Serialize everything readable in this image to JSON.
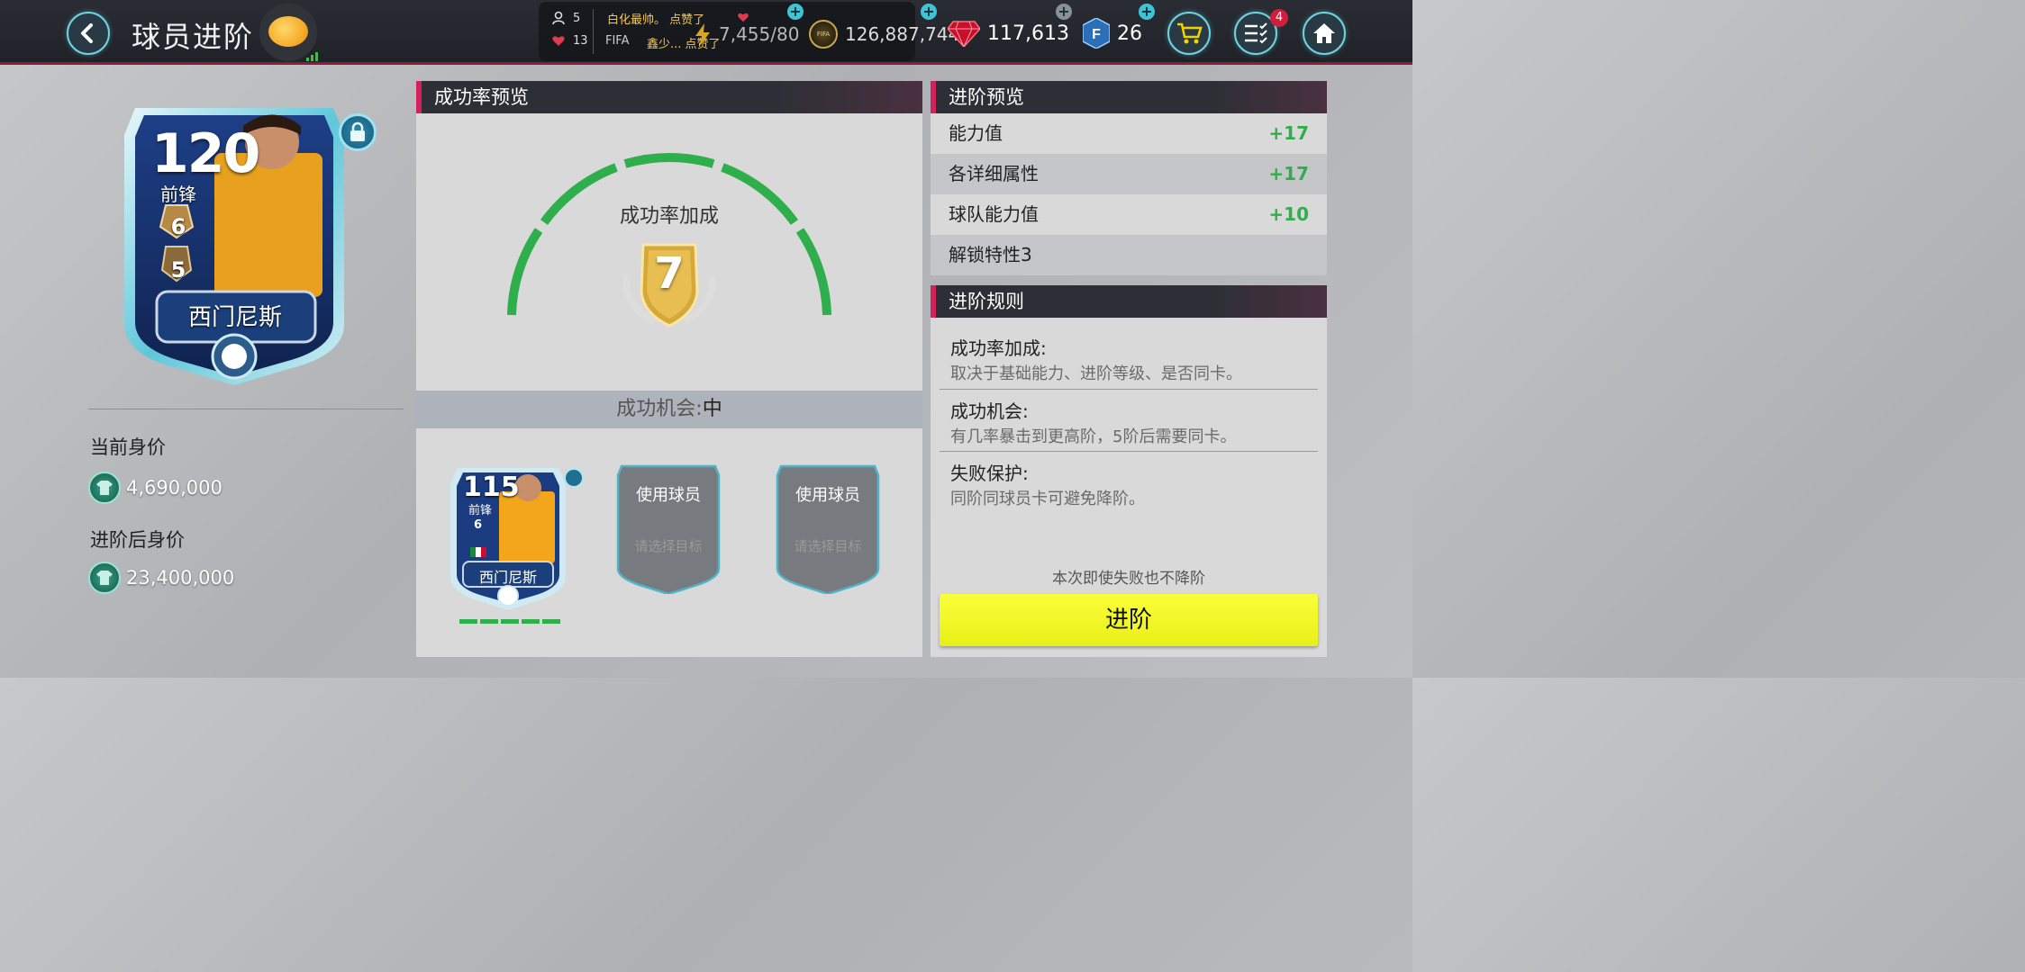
{
  "header": {
    "title": "球员进阶",
    "social": {
      "friends_count": "5",
      "likes_count": "13",
      "chat_line1": "白化最帅。 点赞了",
      "chat_line2_prefix": "FIFA",
      "chat_line2_text": "鑫少... 点赞了"
    },
    "stamina": "7,455/80",
    "coins": "126,887,744",
    "gems": "117,613",
    "fpoints": "26",
    "notification_count": "4"
  },
  "player_card": {
    "rating": "120",
    "position": "前锋",
    "advance_level": "6",
    "training_level": "5",
    "name": "西门尼斯"
  },
  "value": {
    "current_label": "当前身价",
    "current_value": "4,690,000",
    "after_label": "进阶后身价",
    "after_value": "23,400,000"
  },
  "success_panel": {
    "header": "成功率预览",
    "gauge_title": "成功率加成",
    "bonus_value": "7",
    "chance_label": "成功机会:",
    "chance_value": "中",
    "target_card": {
      "rating": "115",
      "position": "前锋",
      "level": "6",
      "name": "西门尼斯"
    },
    "slots": [
      {
        "title": "使用球员",
        "subtitle": "请选择目标"
      },
      {
        "title": "使用球员",
        "subtitle": "请选择目标"
      }
    ]
  },
  "advance_preview": {
    "header": "进阶预览",
    "rows": [
      {
        "label": "能力值",
        "value": "+17"
      },
      {
        "label": "各详细属性",
        "value": "+17"
      },
      {
        "label": "球队能力值",
        "value": "+10"
      },
      {
        "label": "解锁特性3",
        "value": ""
      }
    ]
  },
  "rules": {
    "header": "进阶规则",
    "items": [
      {
        "title": "成功率加成:",
        "desc": "取决于基础能力、进阶等级、是否同卡。"
      },
      {
        "title": "成功机会:",
        "desc": "有几率暴击到更高阶，5阶后需要同卡。"
      },
      {
        "title": "失败保护:",
        "desc": "同阶同球员卡可避免降阶。"
      }
    ],
    "no_fail_note": "本次即使失败也不降阶",
    "advance_button": "进阶"
  },
  "colors": {
    "accent_pink": "#d4215a",
    "gauge_green": "#2fae4c",
    "advance_yellow": "#f3f82a",
    "cyan_button": "#6fd3e0"
  }
}
